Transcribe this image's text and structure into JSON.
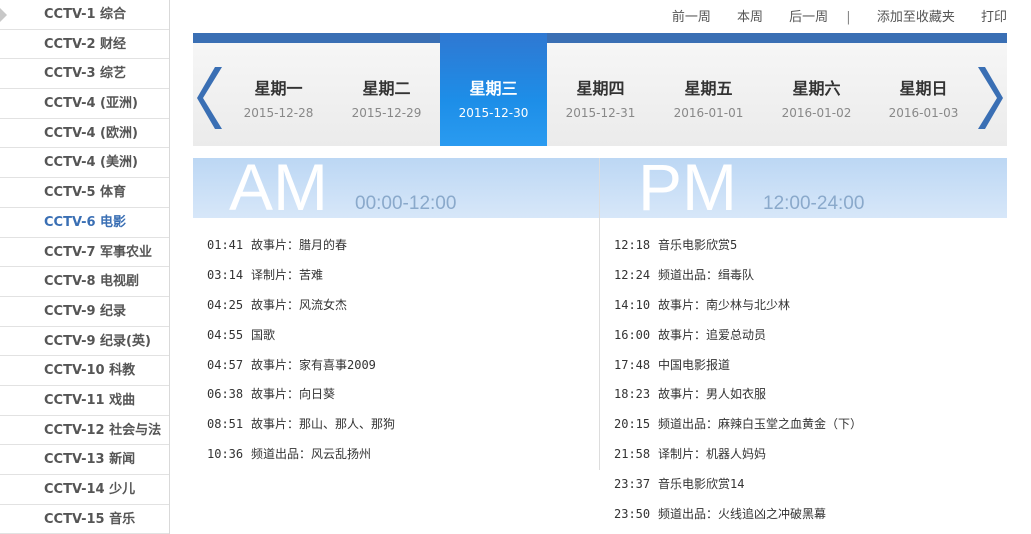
{
  "sidebar": {
    "channels": [
      "CCTV-1 综合",
      "CCTV-2 财经",
      "CCTV-3 综艺",
      "CCTV-4 (亚洲)",
      "CCTV-4 (欧洲)",
      "CCTV-4 (美洲)",
      "CCTV-5 体育",
      "CCTV-6 电影",
      "CCTV-7 军事农业",
      "CCTV-8 电视剧",
      "CCTV-9 纪录",
      "CCTV-9 纪录(英)",
      "CCTV-10 科教",
      "CCTV-11 戏曲",
      "CCTV-12 社会与法",
      "CCTV-13 新闻",
      "CCTV-14 少儿",
      "CCTV-15 音乐"
    ],
    "active_index": 7
  },
  "toolbar": {
    "prev_week": "前一周",
    "this_week": "本周",
    "next_week": "后一周",
    "separator": "|",
    "add_favorite": "添加至收藏夹",
    "print": "打印"
  },
  "week": {
    "days": [
      {
        "name": "星期一",
        "date": "2015-12-28"
      },
      {
        "name": "星期二",
        "date": "2015-12-29"
      },
      {
        "name": "星期三",
        "date": "2015-12-30"
      },
      {
        "name": "星期四",
        "date": "2015-12-31"
      },
      {
        "name": "星期五",
        "date": "2016-01-01"
      },
      {
        "name": "星期六",
        "date": "2016-01-02"
      },
      {
        "name": "星期日",
        "date": "2016-01-03"
      }
    ],
    "active_index": 2,
    "accent_color": "#3a6fb4"
  },
  "am": {
    "label": "AM",
    "range": "00:00-12:00",
    "programs": [
      {
        "time": "01:41",
        "title": "故事片：腊月的春"
      },
      {
        "time": "03:14",
        "title": "译制片：苦难"
      },
      {
        "time": "04:25",
        "title": "故事片：风流女杰"
      },
      {
        "time": "04:55",
        "title": "国歌"
      },
      {
        "time": "04:57",
        "title": "故事片：家有喜事2009"
      },
      {
        "time": "06:38",
        "title": "故事片：向日葵"
      },
      {
        "time": "08:51",
        "title": "故事片：那山、那人、那狗"
      },
      {
        "time": "10:36",
        "title": "频道出品：风云乱扬州"
      }
    ]
  },
  "pm": {
    "label": "PM",
    "range": "12:00-24:00",
    "programs": [
      {
        "time": "12:18",
        "title": "音乐电影欣赏5"
      },
      {
        "time": "12:24",
        "title": "频道出品：缉毒队"
      },
      {
        "time": "14:10",
        "title": "故事片：南少林与北少林"
      },
      {
        "time": "16:00",
        "title": "故事片：追爱总动员"
      },
      {
        "time": "17:48",
        "title": "中国电影报道"
      },
      {
        "time": "18:23",
        "title": "故事片：男人如衣服"
      },
      {
        "time": "20:15",
        "title": "频道出品：麻辣白玉堂之血黄金（下）"
      },
      {
        "time": "21:58",
        "title": "译制片：机器人妈妈"
      },
      {
        "time": "23:37",
        "title": "音乐电影欣赏14"
      },
      {
        "time": "23:50",
        "title": "频道出品：火线追凶之冲破黑幕"
      }
    ]
  }
}
